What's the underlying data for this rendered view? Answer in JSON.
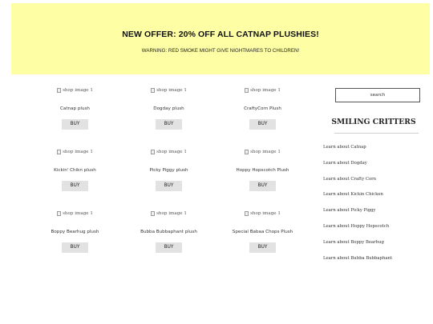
{
  "banner": {
    "title": "NEW OFFER: 20% OFF ALL CATNAP PLUSHIES!",
    "warning": "WARNING: RED SMOKE MIGHT GIVE NIGHTMARES TO CHILDREN!",
    "background": "#fefea4"
  },
  "products": [
    {
      "image_alt": "shop image 1",
      "name": "Catnap plush",
      "button": "BUY"
    },
    {
      "image_alt": "shop image 1",
      "name": "Dogday plush",
      "button": "BUY"
    },
    {
      "image_alt": "shop image 1",
      "name": "CraftyCorn Plush",
      "button": "BUY"
    },
    {
      "image_alt": "shop image 1",
      "name": "Kickin' Chikn plush",
      "button": "BUY"
    },
    {
      "image_alt": "shop image 1",
      "name": "Picky Piggy plush",
      "button": "BUY"
    },
    {
      "image_alt": "shop image 1",
      "name": "Hoppy Hopscotch Plush",
      "button": "BUY"
    },
    {
      "image_alt": "shop image 1",
      "name": "Boppy Bearhug plush",
      "button": "BUY"
    },
    {
      "image_alt": "shop image 1",
      "name": "Bubba Bubbaphant plush",
      "button": "BUY"
    },
    {
      "image_alt": "shop image 1",
      "name": "Special Babaa Chops Plush",
      "button": "BUY"
    }
  ],
  "sidebar": {
    "search_label": "search",
    "brand": "SMILING CRITTERS",
    "links": [
      "Learn about Catnap",
      "Learn about Dogday",
      "Learn about Crafty Corn",
      "Learn about Kickin Chicken",
      "Learn about Picky Piggy",
      "Learn about Hoppy Hopscotch",
      "Learn about Boppy Bearhug",
      "Learn about Bubba Bubbaphant"
    ]
  },
  "icons": {
    "product_image": "broken-image-icon"
  }
}
